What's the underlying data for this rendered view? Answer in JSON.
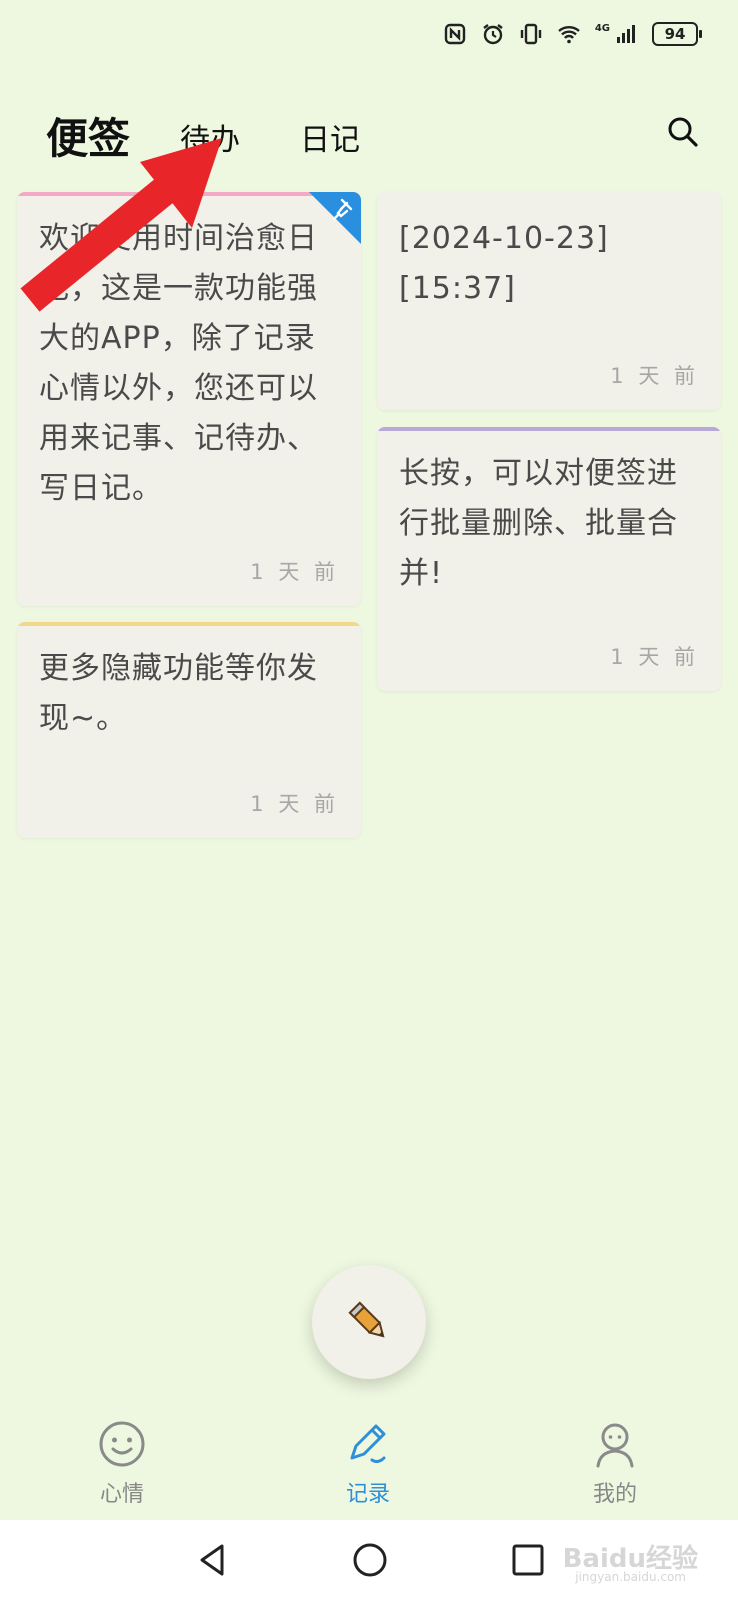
{
  "status": {
    "battery": "94",
    "network": "4G"
  },
  "header": {
    "title": "便签",
    "tabs": [
      {
        "label": "待办"
      },
      {
        "label": "日记"
      }
    ]
  },
  "notes": [
    {
      "text": "欢迎使用时间治愈日记，这是一款功能强大的APP，除了记录心情以外，您还可以用来记事、记待办、写日记。",
      "time": "1 天 前",
      "accent": "#f2a9c3",
      "pinned": true
    },
    {
      "text": "[2024-10-23]\n[15:37]",
      "time": "1 天 前",
      "accent": "",
      "pinned": false
    },
    {
      "text": "长按，可以对便签进行批量删除、批量合并!",
      "time": "1 天 前",
      "accent": "#b9a9d8",
      "pinned": false
    },
    {
      "text": "更多隐藏功能等你发现~。",
      "time": "1 天 前",
      "accent": "#f0d98a",
      "pinned": false
    }
  ],
  "bottom_nav": [
    {
      "label": "心情"
    },
    {
      "label": "记录"
    },
    {
      "label": "我的"
    }
  ],
  "watermark": {
    "brand": "Baidu经验",
    "sub": "jingyan.baidu.com"
  },
  "colors": {
    "background": "#eef8e0",
    "card": "#f1f0e9",
    "active": "#2f8fd9",
    "pin": "#2b8fe0",
    "arrow": "#e8262a"
  }
}
